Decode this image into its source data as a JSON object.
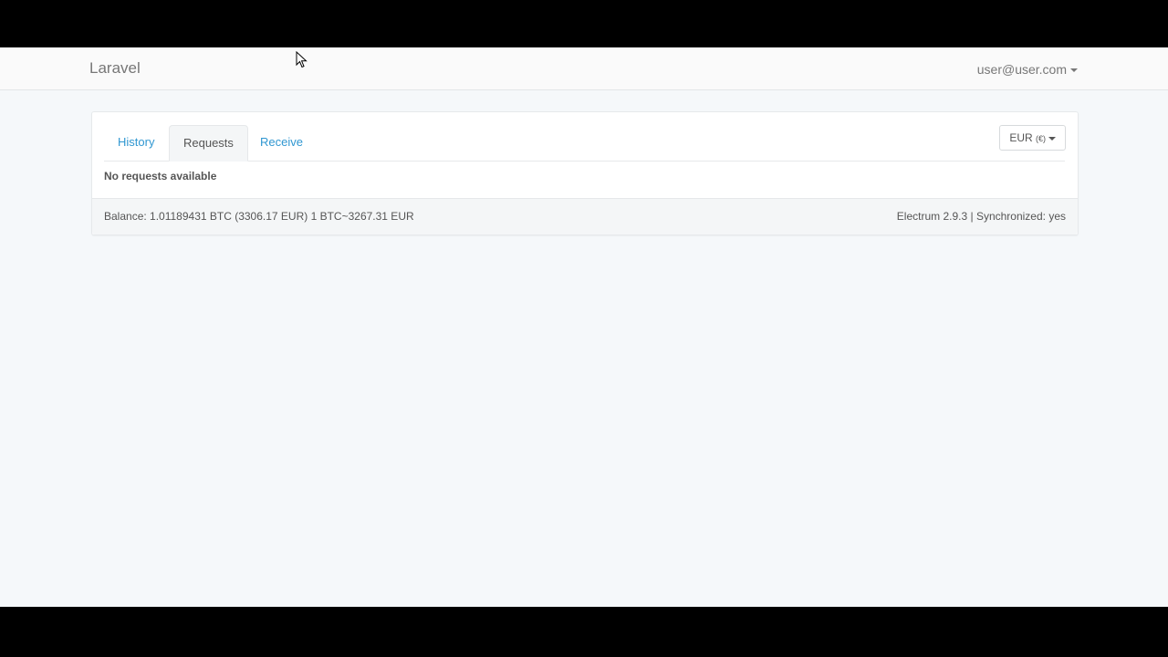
{
  "navbar": {
    "brand": "Laravel",
    "user_email": "user@user.com"
  },
  "tabs": [
    {
      "label": "History",
      "active": false
    },
    {
      "label": "Requests",
      "active": true
    },
    {
      "label": "Receive",
      "active": false
    }
  ],
  "currency": {
    "code": "EUR",
    "symbol": "(€)"
  },
  "requests": {
    "empty_message": "No requests available"
  },
  "footer": {
    "balance": "Balance: 1.01189431 BTC (3306.17 EUR) 1 BTC~3267.31 EUR",
    "status": "Electrum 2.9.3 | Synchronized: yes"
  },
  "colors": {
    "link": "#3097d1",
    "text": "#555555",
    "muted": "#777777",
    "page_background": "#f5f8fa"
  },
  "icons": {
    "dropdown": "caret-down",
    "cursor": "mouse-pointer"
  }
}
